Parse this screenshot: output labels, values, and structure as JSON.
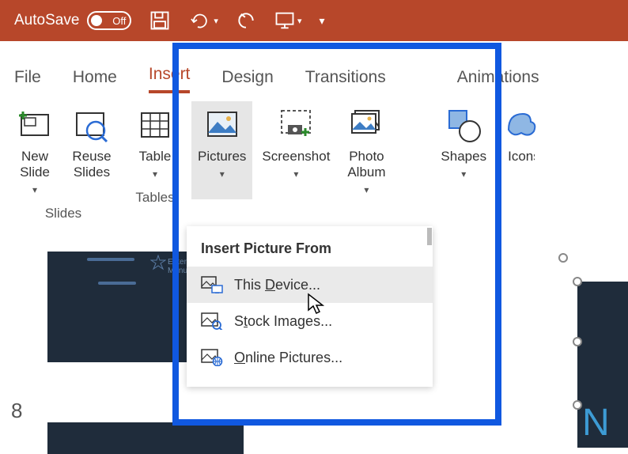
{
  "titlebar": {
    "autosave_label": "AutoSave",
    "autosave_state": "Off"
  },
  "tabs": {
    "file": "File",
    "home": "Home",
    "insert": "Insert",
    "design": "Design",
    "transitions": "Transitions",
    "animations": "Animations"
  },
  "ribbon": {
    "new_slide": "New\nSlide",
    "reuse_slides": "Reuse\nSlides",
    "table": "Table",
    "pictures": "Pictures",
    "screenshot": "Screenshot",
    "photo_album": "Photo\nAlbum",
    "shapes": "Shapes",
    "icons": "Icons",
    "group_slides": "Slides",
    "group_tables": "Tables"
  },
  "dropdown": {
    "header": "Insert Picture From",
    "this_device_prefix": "This ",
    "this_device_mnemonic": "D",
    "this_device_rest": "evice...",
    "stock_prefix": "S",
    "stock_mnemonic": "t",
    "stock_rest": "ock Images...",
    "online_mnemonic": "O",
    "online_rest": "nline Pictures..."
  },
  "slide": {
    "number": "8",
    "thumb_text1": "Enterpr",
    "thumb_text2": "Manufactu"
  }
}
